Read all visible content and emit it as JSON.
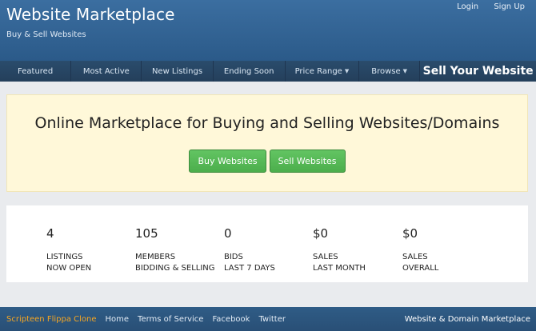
{
  "header": {
    "brand": "Website Marketplace",
    "tagline": "Buy & Sell Websites",
    "login": "Login",
    "signup": "Sign Up"
  },
  "nav": {
    "featured": "Featured",
    "most_active": "Most Active",
    "new_listings": "New Listings",
    "ending_soon": "Ending Soon",
    "price_range": "Price Range",
    "browse": "Browse",
    "sell": "Sell Your Website"
  },
  "hero": {
    "title": "Online Marketplace for Buying and Selling Websites/Domains",
    "buy_button": "Buy Websites",
    "sell_button": "Sell Websites"
  },
  "stats": [
    {
      "value": "4",
      "line1": "LISTINGS",
      "line2": "NOW OPEN"
    },
    {
      "value": "105",
      "line1": "MEMBERS",
      "line2": "BIDDING & SELLING"
    },
    {
      "value": "0",
      "line1": "BIDS",
      "line2": "LAST 7 DAYS"
    },
    {
      "value": "$0",
      "line1": "SALES",
      "line2": "LAST MONTH"
    },
    {
      "value": "$0",
      "line1": "SALES",
      "line2": "OVERALL"
    }
  ],
  "footer": {
    "brand": "Scripteen Flippa Clone",
    "home": "Home",
    "terms": "Terms of Service",
    "facebook": "Facebook",
    "twitter": "Twitter",
    "right": "Website & Domain Marketplace"
  },
  "colors": {
    "header": "#2f6192",
    "nav": "#27445f",
    "hero_bg": "#fff8d9",
    "button_green": "#5cb85c",
    "footer_brand": "#f5a623"
  }
}
